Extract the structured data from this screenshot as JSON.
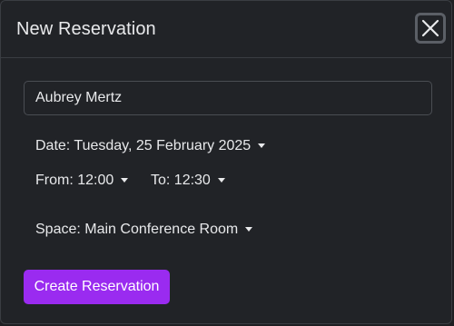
{
  "dialog": {
    "title": "New Reservation",
    "close_icon": "close-icon"
  },
  "form": {
    "name_value": "Aubrey Mertz",
    "date_label": "Date: Tuesday, 25 February 2025",
    "from_label": "From: 12:00",
    "to_label": "To: 12:30",
    "space_label": "Space: Main Conference Room",
    "submit_label": "Create Reservation"
  },
  "colors": {
    "accent": "#9a2bf0",
    "background": "#212327"
  }
}
